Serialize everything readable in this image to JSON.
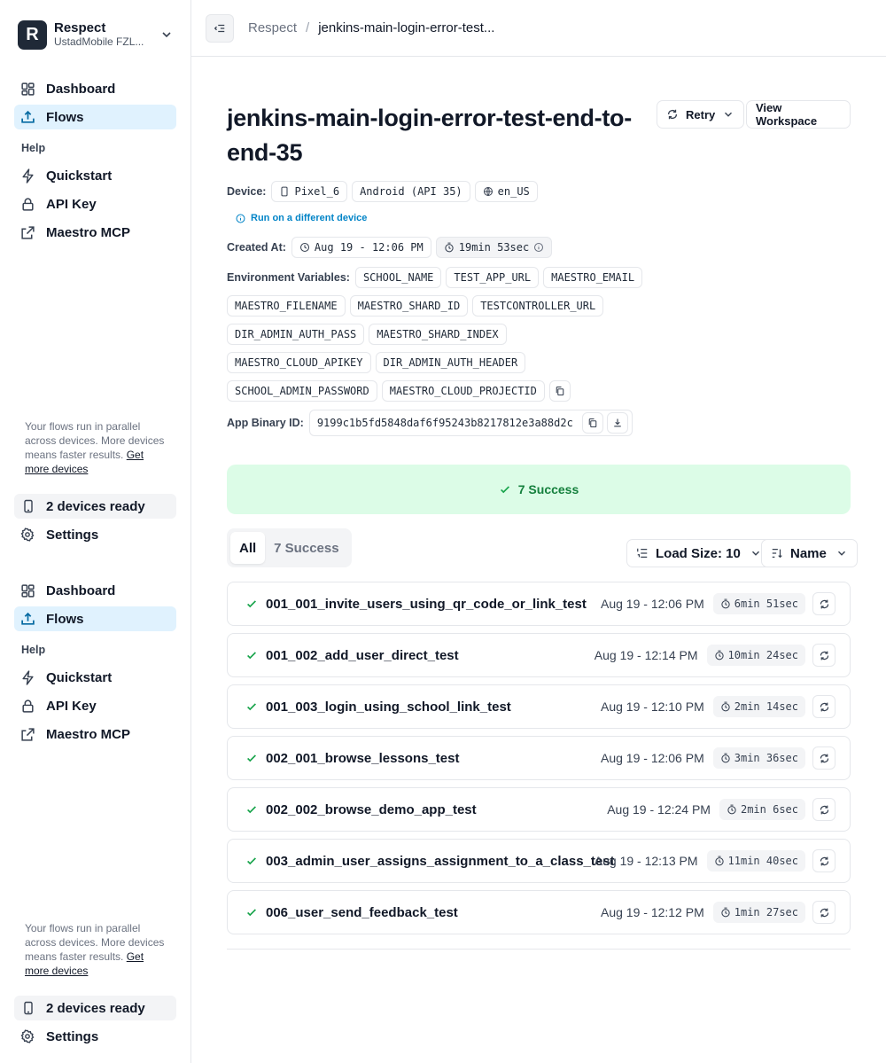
{
  "org": {
    "logo_letter": "R",
    "name": "Respect",
    "subtitle": "UstadMobile FZL..."
  },
  "nav": {
    "dashboard": "Dashboard",
    "flows": "Flows",
    "help_label": "Help",
    "quickstart": "Quickstart",
    "api_key": "API Key",
    "maestro_mcp": "Maestro MCP"
  },
  "promo": {
    "text": "Your flows run in parallel across devices. More devices means faster results.",
    "link": "Get more devices"
  },
  "devices_ready": "2 devices ready",
  "settings": "Settings",
  "breadcrumb": {
    "root": "Respect",
    "separator": "/",
    "current": "jenkins-main-login-error-test..."
  },
  "run": {
    "title": "jenkins-main-login-error-test-end-to-end-35",
    "retry_label": "Retry",
    "view_workspace_label": "View Workspace",
    "device_label": "Device:",
    "device_name": "Pixel_6",
    "os": "Android (API 35)",
    "locale": "en_US",
    "different_device_link": "Run on a different device",
    "created_label": "Created At:",
    "created_at": "Aug 19 - 12:06 PM",
    "duration": "19min 53sec",
    "env_label": "Environment Variables:",
    "env_vars": [
      "SCHOOL_NAME",
      "TEST_APP_URL",
      "MAESTRO_EMAIL",
      "MAESTRO_FILENAME",
      "MAESTRO_SHARD_ID",
      "TESTCONTROLLER_URL",
      "DIR_ADMIN_AUTH_PASS",
      "MAESTRO_SHARD_INDEX",
      "MAESTRO_CLOUD_APIKEY",
      "DIR_ADMIN_AUTH_HEADER",
      "SCHOOL_ADMIN_PASSWORD",
      "MAESTRO_CLOUD_PROJECTID"
    ],
    "binary_label": "App Binary ID:",
    "binary_id": "9199c1b5fd5848daf6f95243b8217812e3a88d2c"
  },
  "summary": {
    "success_text": "7 Success"
  },
  "tabs": {
    "all": "All",
    "success": "7 Success"
  },
  "controls": {
    "load_size": "Load Size: 10",
    "sort": "Name"
  },
  "flows": [
    {
      "name": "001_001_invite_users_using_qr_code_or_link_test",
      "date": "Aug 19 - 12:06 PM",
      "duration": "6min 51sec"
    },
    {
      "name": "001_002_add_user_direct_test",
      "date": "Aug 19 - 12:14 PM",
      "duration": "10min 24sec"
    },
    {
      "name": "001_003_login_using_school_link_test",
      "date": "Aug 19 - 12:10 PM",
      "duration": "2min 14sec"
    },
    {
      "name": "002_001_browse_lessons_test",
      "date": "Aug 19 - 12:06 PM",
      "duration": "3min 36sec"
    },
    {
      "name": "002_002_browse_demo_app_test",
      "date": "Aug 19 - 12:24 PM",
      "duration": "2min 6sec"
    },
    {
      "name": "003_admin_user_assigns_assignment_to_a_class_test",
      "date": "Aug 19 - 12:13 PM",
      "duration": "11min 40sec"
    },
    {
      "name": "006_user_send_feedback_test",
      "date": "Aug 19 - 12:12 PM",
      "duration": "1min 27sec"
    }
  ],
  "colors": {
    "accent_bg": "#e0f2fe",
    "success_bg": "#dcfce7",
    "success_text": "#15803d",
    "link": "#0284c7"
  }
}
